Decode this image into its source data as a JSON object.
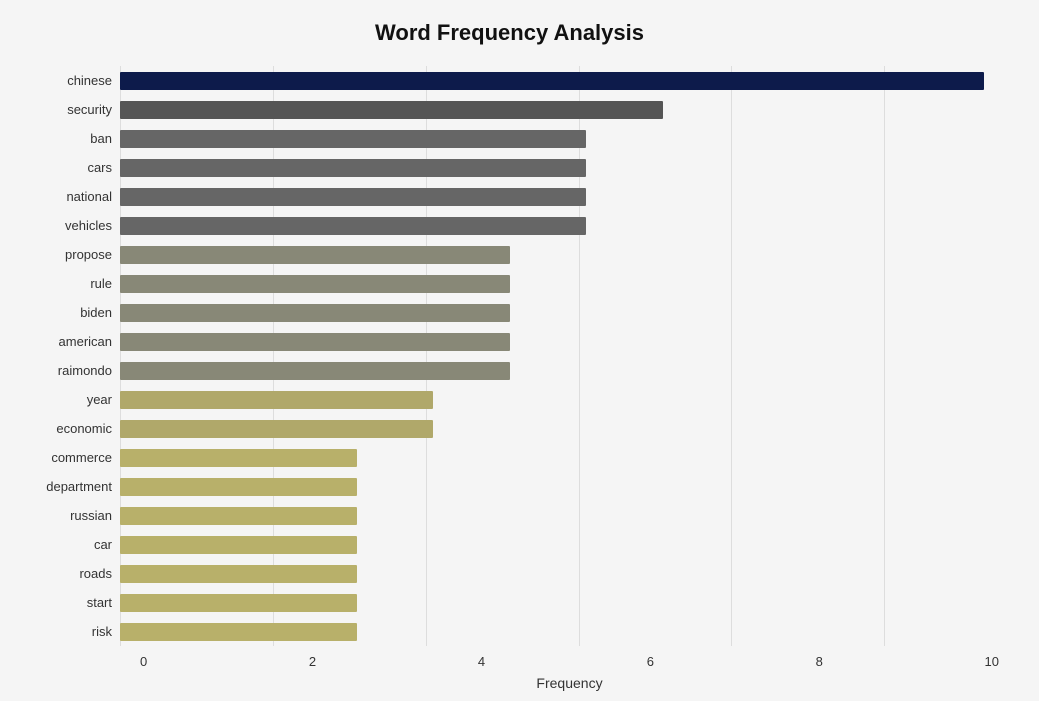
{
  "chart": {
    "title": "Word Frequency Analysis",
    "x_axis_label": "Frequency",
    "x_ticks": [
      "0",
      "2",
      "4",
      "6",
      "8",
      "10"
    ],
    "max_value": 11.5,
    "bars": [
      {
        "label": "chinese",
        "value": 11.3,
        "color": "#0d1b4b"
      },
      {
        "label": "security",
        "value": 7.1,
        "color": "#555555"
      },
      {
        "label": "ban",
        "value": 6.1,
        "color": "#666666"
      },
      {
        "label": "cars",
        "value": 6.1,
        "color": "#666666"
      },
      {
        "label": "national",
        "value": 6.1,
        "color": "#666666"
      },
      {
        "label": "vehicles",
        "value": 6.1,
        "color": "#666666"
      },
      {
        "label": "propose",
        "value": 5.1,
        "color": "#888877"
      },
      {
        "label": "rule",
        "value": 5.1,
        "color": "#888877"
      },
      {
        "label": "biden",
        "value": 5.1,
        "color": "#888877"
      },
      {
        "label": "american",
        "value": 5.1,
        "color": "#888877"
      },
      {
        "label": "raimondo",
        "value": 5.1,
        "color": "#888877"
      },
      {
        "label": "year",
        "value": 4.1,
        "color": "#b0a86a"
      },
      {
        "label": "economic",
        "value": 4.1,
        "color": "#b0a86a"
      },
      {
        "label": "commerce",
        "value": 3.1,
        "color": "#b8b06a"
      },
      {
        "label": "department",
        "value": 3.1,
        "color": "#b8b06a"
      },
      {
        "label": "russian",
        "value": 3.1,
        "color": "#b8b06a"
      },
      {
        "label": "car",
        "value": 3.1,
        "color": "#b8b06a"
      },
      {
        "label": "roads",
        "value": 3.1,
        "color": "#b8b06a"
      },
      {
        "label": "start",
        "value": 3.1,
        "color": "#b8b06a"
      },
      {
        "label": "risk",
        "value": 3.1,
        "color": "#b8b06a"
      }
    ]
  }
}
